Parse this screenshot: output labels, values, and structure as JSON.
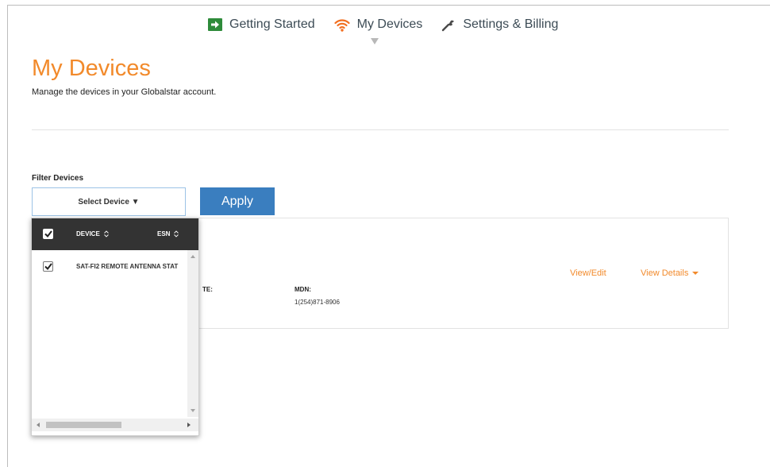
{
  "nav": {
    "items": [
      {
        "label": "Getting Started",
        "icon": "arrow-right-icon"
      },
      {
        "label": "My Devices",
        "icon": "wifi-icon"
      },
      {
        "label": "Settings & Billing",
        "icon": "wrench-icon"
      }
    ],
    "active": "My Devices"
  },
  "header": {
    "title": "My Devices",
    "subtitle": "Manage the devices in your Globalstar account."
  },
  "filter": {
    "label": "Filter Devices",
    "select_label": "Select Device ▼",
    "apply_label": "Apply"
  },
  "dropdown": {
    "columns": {
      "device": "DEVICE",
      "esn": "ESN"
    },
    "select_all_checked": true,
    "rows": [
      {
        "device": "SAT-FI2 REMOTE ANTENNA STAT",
        "checked": true
      }
    ]
  },
  "device_card": {
    "partial_label": "TE:",
    "mdn_label": "MDN:",
    "mdn_value": "1(254)871-8906",
    "view_edit": "View/Edit",
    "view_details": "View Details"
  },
  "colors": {
    "accent_orange": "#f28a2b",
    "apply_blue": "#3a7ebf",
    "nav_text": "#3c4b55",
    "getting_started_green": "#2e8b3a",
    "dropdown_header": "#333333"
  }
}
